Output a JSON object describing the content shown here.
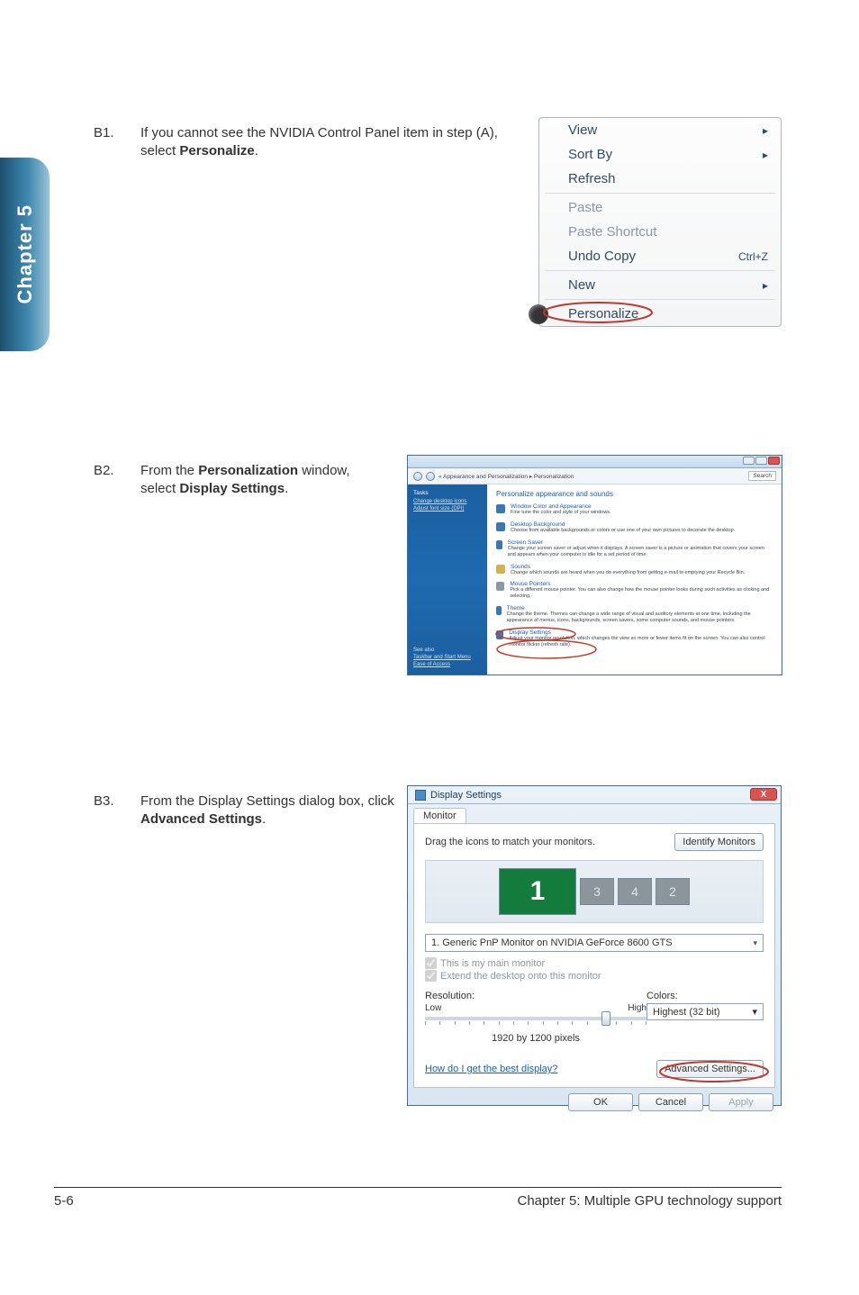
{
  "side_tab": "Chapter 5",
  "b1": {
    "num": "B1.",
    "text_a": "If you cannot see the NVIDIA Control Panel item in step (A), select ",
    "text_b": "Personalize",
    "text_c": "."
  },
  "ctx": {
    "view": "View",
    "sort_by": "Sort By",
    "refresh": "Refresh",
    "paste": "Paste",
    "paste_shortcut": "Paste Shortcut",
    "undo_copy": "Undo Copy",
    "undo_copy_accel": "Ctrl+Z",
    "new": "New",
    "personalize": "Personalize",
    "arrow": "▸"
  },
  "b2": {
    "num": "B2.",
    "text_a": "From the ",
    "text_b": "Personalization",
    "text_c": " window, select ",
    "text_d": "Display Settings",
    "text_e": "."
  },
  "pers": {
    "breadcrumb": "« Appearance and Personalization ▸ Personalization",
    "search": "Search",
    "tasks": "Tasks",
    "side_links": [
      "Change desktop icons",
      "Adjust font size (DPI)"
    ],
    "see_also": "See also",
    "see_also_items": [
      "Taskbar and Start Menu",
      "Ease of Access"
    ],
    "heading": "Personalize appearance and sounds",
    "items": [
      {
        "title": "Window Color and Appearance",
        "desc": "Fine tune the color and style of your windows."
      },
      {
        "title": "Desktop Background",
        "desc": "Choose from available backgrounds or colors or use one of your own pictures to decorate the desktop."
      },
      {
        "title": "Screen Saver",
        "desc": "Change your screen saver or adjust when it displays. A screen saver is a picture or animation that covers your screen and appears when your computer is idle for a set period of time."
      },
      {
        "title": "Sounds",
        "desc": "Change which sounds are heard when you do everything from getting e-mail to emptying your Recycle Bin."
      },
      {
        "title": "Mouse Pointers",
        "desc": "Pick a different mouse pointer. You can also change how the mouse pointer looks during such activities as clicking and selecting."
      },
      {
        "title": "Theme",
        "desc": "Change the theme. Themes can change a wide range of visual and auditory elements at one time, including the appearance of menus, icons, backgrounds, screen savers, some computer sounds, and mouse pointers."
      },
      {
        "title": "Display Settings",
        "desc": "Adjust your monitor resolution, which changes the view so more or fewer items fit on the screen. You can also control monitor flicker (refresh rate)."
      }
    ]
  },
  "b3": {
    "num": "B3.",
    "text_a": "From the Display Settings dialog box, click ",
    "text_b": "Advanced Settings",
    "text_c": "."
  },
  "ds": {
    "title": "Display Settings",
    "close": "X",
    "tab": "Monitor",
    "drag_label": "Drag the icons to match your monitors.",
    "identify_btn": "Identify Monitors",
    "monitors": [
      "1",
      "3",
      "4",
      "2"
    ],
    "monitor_sel": "1. Generic PnP Monitor on NVIDIA GeForce 8600 GTS",
    "chk_main": "This is my main monitor",
    "chk_extend": "Extend the desktop onto this monitor",
    "resolution_label": "Resolution:",
    "colors_label": "Colors:",
    "slider_low": "Low",
    "slider_high": "High",
    "resolution_value": "1920 by 1200 pixels",
    "colors_value": "Highest (32 bit)",
    "help_link": "How do I get the best display?",
    "adv_btn": "Advanced Settings...",
    "ok": "OK",
    "cancel": "Cancel",
    "apply": "Apply",
    "dd_arrow": "▾"
  },
  "footer": {
    "left": "5-6",
    "right": "Chapter 5: Multiple GPU technology support"
  }
}
